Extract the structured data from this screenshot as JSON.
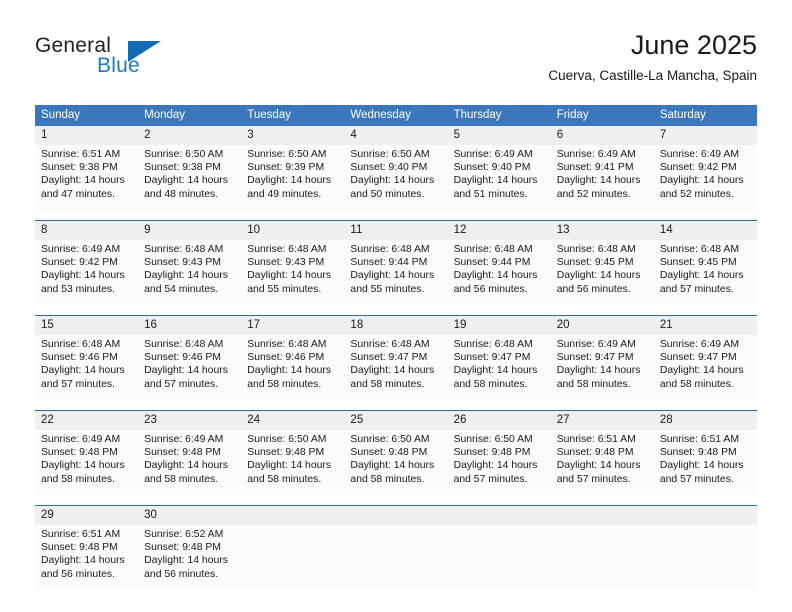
{
  "branding": {
    "name_top": "General",
    "name_bottom": "Blue",
    "triangle_color": "#0e6db5",
    "blue_color": "#1f7ac2"
  },
  "header": {
    "title": "June 2025",
    "subtitle": "Cuerva, Castille-La Mancha, Spain"
  },
  "theme": {
    "header_bg": "#3b77bd",
    "header_text": "#ffffff",
    "daynum_bg": "#efeff0",
    "cell_bg": "#fbfbfc",
    "separator": "#2e6ca8"
  },
  "calendar": {
    "weekday_headers": [
      "Sunday",
      "Monday",
      "Tuesday",
      "Wednesday",
      "Thursday",
      "Friday",
      "Saturday"
    ],
    "weeks": [
      {
        "days": [
          {
            "num": "1",
            "sunrise": "Sunrise: 6:51 AM",
            "sunset": "Sunset: 9:38 PM",
            "daylight1": "Daylight: 14 hours",
            "daylight2": "and 47 minutes."
          },
          {
            "num": "2",
            "sunrise": "Sunrise: 6:50 AM",
            "sunset": "Sunset: 9:38 PM",
            "daylight1": "Daylight: 14 hours",
            "daylight2": "and 48 minutes."
          },
          {
            "num": "3",
            "sunrise": "Sunrise: 6:50 AM",
            "sunset": "Sunset: 9:39 PM",
            "daylight1": "Daylight: 14 hours",
            "daylight2": "and 49 minutes."
          },
          {
            "num": "4",
            "sunrise": "Sunrise: 6:50 AM",
            "sunset": "Sunset: 9:40 PM",
            "daylight1": "Daylight: 14 hours",
            "daylight2": "and 50 minutes."
          },
          {
            "num": "5",
            "sunrise": "Sunrise: 6:49 AM",
            "sunset": "Sunset: 9:40 PM",
            "daylight1": "Daylight: 14 hours",
            "daylight2": "and 51 minutes."
          },
          {
            "num": "6",
            "sunrise": "Sunrise: 6:49 AM",
            "sunset": "Sunset: 9:41 PM",
            "daylight1": "Daylight: 14 hours",
            "daylight2": "and 52 minutes."
          },
          {
            "num": "7",
            "sunrise": "Sunrise: 6:49 AM",
            "sunset": "Sunset: 9:42 PM",
            "daylight1": "Daylight: 14 hours",
            "daylight2": "and 52 minutes."
          }
        ]
      },
      {
        "days": [
          {
            "num": "8",
            "sunrise": "Sunrise: 6:49 AM",
            "sunset": "Sunset: 9:42 PM",
            "daylight1": "Daylight: 14 hours",
            "daylight2": "and 53 minutes."
          },
          {
            "num": "9",
            "sunrise": "Sunrise: 6:48 AM",
            "sunset": "Sunset: 9:43 PM",
            "daylight1": "Daylight: 14 hours",
            "daylight2": "and 54 minutes."
          },
          {
            "num": "10",
            "sunrise": "Sunrise: 6:48 AM",
            "sunset": "Sunset: 9:43 PM",
            "daylight1": "Daylight: 14 hours",
            "daylight2": "and 55 minutes."
          },
          {
            "num": "11",
            "sunrise": "Sunrise: 6:48 AM",
            "sunset": "Sunset: 9:44 PM",
            "daylight1": "Daylight: 14 hours",
            "daylight2": "and 55 minutes."
          },
          {
            "num": "12",
            "sunrise": "Sunrise: 6:48 AM",
            "sunset": "Sunset: 9:44 PM",
            "daylight1": "Daylight: 14 hours",
            "daylight2": "and 56 minutes."
          },
          {
            "num": "13",
            "sunrise": "Sunrise: 6:48 AM",
            "sunset": "Sunset: 9:45 PM",
            "daylight1": "Daylight: 14 hours",
            "daylight2": "and 56 minutes."
          },
          {
            "num": "14",
            "sunrise": "Sunrise: 6:48 AM",
            "sunset": "Sunset: 9:45 PM",
            "daylight1": "Daylight: 14 hours",
            "daylight2": "and 57 minutes."
          }
        ]
      },
      {
        "days": [
          {
            "num": "15",
            "sunrise": "Sunrise: 6:48 AM",
            "sunset": "Sunset: 9:46 PM",
            "daylight1": "Daylight: 14 hours",
            "daylight2": "and 57 minutes."
          },
          {
            "num": "16",
            "sunrise": "Sunrise: 6:48 AM",
            "sunset": "Sunset: 9:46 PM",
            "daylight1": "Daylight: 14 hours",
            "daylight2": "and 57 minutes."
          },
          {
            "num": "17",
            "sunrise": "Sunrise: 6:48 AM",
            "sunset": "Sunset: 9:46 PM",
            "daylight1": "Daylight: 14 hours",
            "daylight2": "and 58 minutes."
          },
          {
            "num": "18",
            "sunrise": "Sunrise: 6:48 AM",
            "sunset": "Sunset: 9:47 PM",
            "daylight1": "Daylight: 14 hours",
            "daylight2": "and 58 minutes."
          },
          {
            "num": "19",
            "sunrise": "Sunrise: 6:48 AM",
            "sunset": "Sunset: 9:47 PM",
            "daylight1": "Daylight: 14 hours",
            "daylight2": "and 58 minutes."
          },
          {
            "num": "20",
            "sunrise": "Sunrise: 6:49 AM",
            "sunset": "Sunset: 9:47 PM",
            "daylight1": "Daylight: 14 hours",
            "daylight2": "and 58 minutes."
          },
          {
            "num": "21",
            "sunrise": "Sunrise: 6:49 AM",
            "sunset": "Sunset: 9:47 PM",
            "daylight1": "Daylight: 14 hours",
            "daylight2": "and 58 minutes."
          }
        ]
      },
      {
        "days": [
          {
            "num": "22",
            "sunrise": "Sunrise: 6:49 AM",
            "sunset": "Sunset: 9:48 PM",
            "daylight1": "Daylight: 14 hours",
            "daylight2": "and 58 minutes."
          },
          {
            "num": "23",
            "sunrise": "Sunrise: 6:49 AM",
            "sunset": "Sunset: 9:48 PM",
            "daylight1": "Daylight: 14 hours",
            "daylight2": "and 58 minutes."
          },
          {
            "num": "24",
            "sunrise": "Sunrise: 6:50 AM",
            "sunset": "Sunset: 9:48 PM",
            "daylight1": "Daylight: 14 hours",
            "daylight2": "and 58 minutes."
          },
          {
            "num": "25",
            "sunrise": "Sunrise: 6:50 AM",
            "sunset": "Sunset: 9:48 PM",
            "daylight1": "Daylight: 14 hours",
            "daylight2": "and 58 minutes."
          },
          {
            "num": "26",
            "sunrise": "Sunrise: 6:50 AM",
            "sunset": "Sunset: 9:48 PM",
            "daylight1": "Daylight: 14 hours",
            "daylight2": "and 57 minutes."
          },
          {
            "num": "27",
            "sunrise": "Sunrise: 6:51 AM",
            "sunset": "Sunset: 9:48 PM",
            "daylight1": "Daylight: 14 hours",
            "daylight2": "and 57 minutes."
          },
          {
            "num": "28",
            "sunrise": "Sunrise: 6:51 AM",
            "sunset": "Sunset: 9:48 PM",
            "daylight1": "Daylight: 14 hours",
            "daylight2": "and 57 minutes."
          }
        ]
      },
      {
        "days": [
          {
            "num": "29",
            "sunrise": "Sunrise: 6:51 AM",
            "sunset": "Sunset: 9:48 PM",
            "daylight1": "Daylight: 14 hours",
            "daylight2": "and 56 minutes."
          },
          {
            "num": "30",
            "sunrise": "Sunrise: 6:52 AM",
            "sunset": "Sunset: 9:48 PM",
            "daylight1": "Daylight: 14 hours",
            "daylight2": "and 56 minutes."
          },
          {
            "num": "",
            "sunrise": "",
            "sunset": "",
            "daylight1": "",
            "daylight2": ""
          },
          {
            "num": "",
            "sunrise": "",
            "sunset": "",
            "daylight1": "",
            "daylight2": ""
          },
          {
            "num": "",
            "sunrise": "",
            "sunset": "",
            "daylight1": "",
            "daylight2": ""
          },
          {
            "num": "",
            "sunrise": "",
            "sunset": "",
            "daylight1": "",
            "daylight2": ""
          },
          {
            "num": "",
            "sunrise": "",
            "sunset": "",
            "daylight1": "",
            "daylight2": ""
          }
        ]
      }
    ]
  }
}
